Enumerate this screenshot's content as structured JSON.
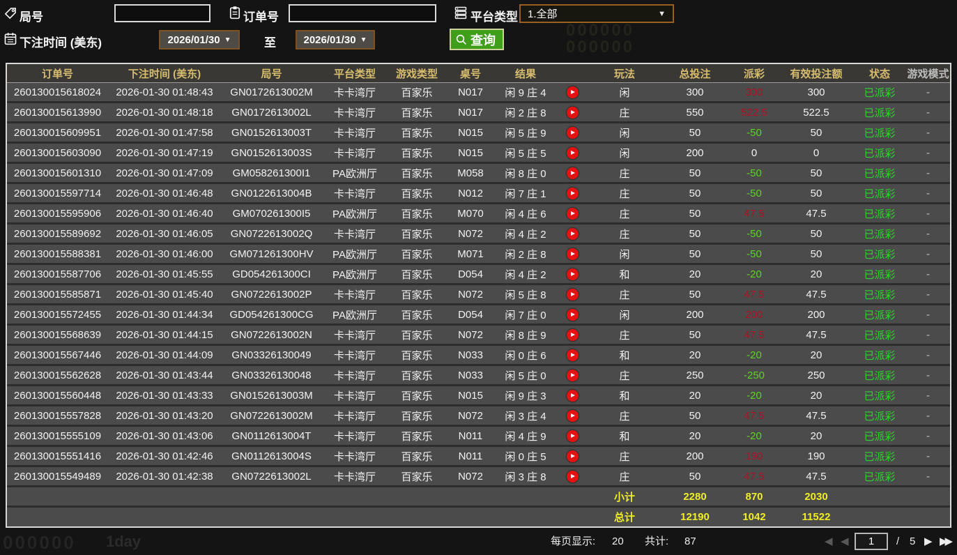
{
  "colors": {
    "gold": "#d8bd6e",
    "win": "#b01126",
    "loss": "#5bd61f",
    "status": "#2fd32f",
    "yellow": "#f0ee22",
    "btn-green": "#3f9e1a"
  },
  "watermarks": [
    "000000",
    "000000",
    "000000",
    "1day"
  ],
  "filters": {
    "round_label": "局号",
    "order_label": "订单号",
    "platform_label": "平台类型",
    "platform_value": "1.全部",
    "bet_time_label": "下注时间 (美东)",
    "date_from": "2026/01/30",
    "date_to": "2026/01/30",
    "to_label": "至",
    "search_label": "查询",
    "round_value": "",
    "order_value": ""
  },
  "icons": {
    "caret": "▼",
    "first": "◀",
    "prev": "◀",
    "next": "▶",
    "last": "▶▶"
  },
  "table": {
    "headers": [
      "订单号",
      "下注时间 (美东)",
      "局号",
      "平台类型",
      "游戏类型",
      "桌号",
      "结果",
      "",
      "玩法",
      "总投注",
      "派彩",
      "有效投注额",
      "状态",
      "游戏模式"
    ],
    "fields": [
      "order",
      "time",
      "round",
      "platform",
      "game",
      "table",
      "result",
      "play",
      "bet",
      "total",
      "payout",
      "valid",
      "status",
      "mode"
    ],
    "rows": [
      {
        "order": "260130015618024",
        "time": "2026-01-30 01:48:43",
        "round": "GN0172613002M",
        "platform": "卡卡湾厅",
        "game": "百家乐",
        "table": "N017",
        "result": "闲 9 庄 4",
        "bet": "闲",
        "total": "300",
        "payout": "300",
        "pclass": "win",
        "valid": "300",
        "status": "已派彩",
        "mode": "-"
      },
      {
        "order": "260130015613990",
        "time": "2026-01-30 01:48:18",
        "round": "GN0172613002L",
        "platform": "卡卡湾厅",
        "game": "百家乐",
        "table": "N017",
        "result": "闲 2 庄 8",
        "bet": "庄",
        "total": "550",
        "payout": "522.5",
        "pclass": "win",
        "valid": "522.5",
        "status": "已派彩",
        "mode": "-"
      },
      {
        "order": "260130015609951",
        "time": "2026-01-30 01:47:58",
        "round": "GN0152613003T",
        "platform": "卡卡湾厅",
        "game": "百家乐",
        "table": "N015",
        "result": "闲 5 庄 9",
        "bet": "闲",
        "total": "50",
        "payout": "-50",
        "pclass": "loss",
        "valid": "50",
        "status": "已派彩",
        "mode": "-"
      },
      {
        "order": "260130015603090",
        "time": "2026-01-30 01:47:19",
        "round": "GN0152613003S",
        "platform": "卡卡湾厅",
        "game": "百家乐",
        "table": "N015",
        "result": "闲 5 庄 5",
        "bet": "闲",
        "total": "200",
        "payout": "0",
        "pclass": "zero",
        "valid": "0",
        "status": "已派彩",
        "mode": "-"
      },
      {
        "order": "260130015601310",
        "time": "2026-01-30 01:47:09",
        "round": "GM058261300I1",
        "platform": "PA欧洲厅",
        "game": "百家乐",
        "table": "M058",
        "result": "闲 8 庄 0",
        "bet": "庄",
        "total": "50",
        "payout": "-50",
        "pclass": "loss",
        "valid": "50",
        "status": "已派彩",
        "mode": "-"
      },
      {
        "order": "260130015597714",
        "time": "2026-01-30 01:46:48",
        "round": "GN0122613004B",
        "platform": "卡卡湾厅",
        "game": "百家乐",
        "table": "N012",
        "result": "闲 7 庄 1",
        "bet": "庄",
        "total": "50",
        "payout": "-50",
        "pclass": "loss",
        "valid": "50",
        "status": "已派彩",
        "mode": "-"
      },
      {
        "order": "260130015595906",
        "time": "2026-01-30 01:46:40",
        "round": "GM070261300I5",
        "platform": "PA欧洲厅",
        "game": "百家乐",
        "table": "M070",
        "result": "闲 4 庄 6",
        "bet": "庄",
        "total": "50",
        "payout": "47.5",
        "pclass": "win",
        "valid": "47.5",
        "status": "已派彩",
        "mode": "-"
      },
      {
        "order": "260130015589692",
        "time": "2026-01-30 01:46:05",
        "round": "GN0722613002Q",
        "platform": "卡卡湾厅",
        "game": "百家乐",
        "table": "N072",
        "result": "闲 4 庄 2",
        "bet": "庄",
        "total": "50",
        "payout": "-50",
        "pclass": "loss",
        "valid": "50",
        "status": "已派彩",
        "mode": "-"
      },
      {
        "order": "260130015588381",
        "time": "2026-01-30 01:46:00",
        "round": "GM071261300HV",
        "platform": "PA欧洲厅",
        "game": "百家乐",
        "table": "M071",
        "result": "闲 2 庄 8",
        "bet": "闲",
        "total": "50",
        "payout": "-50",
        "pclass": "loss",
        "valid": "50",
        "status": "已派彩",
        "mode": "-"
      },
      {
        "order": "260130015587706",
        "time": "2026-01-30 01:45:55",
        "round": "GD054261300CI",
        "platform": "PA欧洲厅",
        "game": "百家乐",
        "table": "D054",
        "result": "闲 4 庄 2",
        "bet": "和",
        "total": "20",
        "payout": "-20",
        "pclass": "loss",
        "valid": "20",
        "status": "已派彩",
        "mode": "-"
      },
      {
        "order": "260130015585871",
        "time": "2026-01-30 01:45:40",
        "round": "GN0722613002P",
        "platform": "卡卡湾厅",
        "game": "百家乐",
        "table": "N072",
        "result": "闲 5 庄 8",
        "bet": "庄",
        "total": "50",
        "payout": "47.5",
        "pclass": "win",
        "valid": "47.5",
        "status": "已派彩",
        "mode": "-"
      },
      {
        "order": "260130015572455",
        "time": "2026-01-30 01:44:34",
        "round": "GD054261300CG",
        "platform": "PA欧洲厅",
        "game": "百家乐",
        "table": "D054",
        "result": "闲 7 庄 0",
        "bet": "闲",
        "total": "200",
        "payout": "200",
        "pclass": "win",
        "valid": "200",
        "status": "已派彩",
        "mode": "-"
      },
      {
        "order": "260130015568639",
        "time": "2026-01-30 01:44:15",
        "round": "GN0722613002N",
        "platform": "卡卡湾厅",
        "game": "百家乐",
        "table": "N072",
        "result": "闲 8 庄 9",
        "bet": "庄",
        "total": "50",
        "payout": "47.5",
        "pclass": "win",
        "valid": "47.5",
        "status": "已派彩",
        "mode": "-"
      },
      {
        "order": "260130015567446",
        "time": "2026-01-30 01:44:09",
        "round": "GN03326130049",
        "platform": "卡卡湾厅",
        "game": "百家乐",
        "table": "N033",
        "result": "闲 0 庄 6",
        "bet": "和",
        "total": "20",
        "payout": "-20",
        "pclass": "loss",
        "valid": "20",
        "status": "已派彩",
        "mode": "-"
      },
      {
        "order": "260130015562628",
        "time": "2026-01-30 01:43:44",
        "round": "GN03326130048",
        "platform": "卡卡湾厅",
        "game": "百家乐",
        "table": "N033",
        "result": "闲 5 庄 0",
        "bet": "庄",
        "total": "250",
        "payout": "-250",
        "pclass": "loss",
        "valid": "250",
        "status": "已派彩",
        "mode": "-"
      },
      {
        "order": "260130015560448",
        "time": "2026-01-30 01:43:33",
        "round": "GN0152613003M",
        "platform": "卡卡湾厅",
        "game": "百家乐",
        "table": "N015",
        "result": "闲 9 庄 3",
        "bet": "和",
        "total": "20",
        "payout": "-20",
        "pclass": "loss",
        "valid": "20",
        "status": "已派彩",
        "mode": "-"
      },
      {
        "order": "260130015557828",
        "time": "2026-01-30 01:43:20",
        "round": "GN0722613002M",
        "platform": "卡卡湾厅",
        "game": "百家乐",
        "table": "N072",
        "result": "闲 3 庄 4",
        "bet": "庄",
        "total": "50",
        "payout": "47.5",
        "pclass": "win",
        "valid": "47.5",
        "status": "已派彩",
        "mode": "-"
      },
      {
        "order": "260130015555109",
        "time": "2026-01-30 01:43:06",
        "round": "GN0112613004T",
        "platform": "卡卡湾厅",
        "game": "百家乐",
        "table": "N011",
        "result": "闲 4 庄 9",
        "bet": "和",
        "total": "20",
        "payout": "-20",
        "pclass": "loss",
        "valid": "20",
        "status": "已派彩",
        "mode": "-"
      },
      {
        "order": "260130015551416",
        "time": "2026-01-30 01:42:46",
        "round": "GN0112613004S",
        "platform": "卡卡湾厅",
        "game": "百家乐",
        "table": "N011",
        "result": "闲 0 庄 5",
        "bet": "庄",
        "total": "200",
        "payout": "190",
        "pclass": "win",
        "valid": "190",
        "status": "已派彩",
        "mode": "-"
      },
      {
        "order": "260130015549489",
        "time": "2026-01-30 01:42:38",
        "round": "GN0722613002L",
        "platform": "卡卡湾厅",
        "game": "百家乐",
        "table": "N072",
        "result": "闲 3 庄 8",
        "bet": "庄",
        "total": "50",
        "payout": "47.5",
        "pclass": "win",
        "valid": "47.5",
        "status": "已派彩",
        "mode": "-"
      }
    ]
  },
  "summary": {
    "subtotal_label": "小计",
    "subtotal_values": [
      "2280",
      "870",
      "2030"
    ],
    "total_label": "总计",
    "total_values": [
      "12190",
      "1042",
      "11522"
    ]
  },
  "footer": {
    "per_page_label": "每页显示:",
    "per_page_value": "20",
    "total_count_label": "共计:",
    "total_count_value": "87",
    "page_current": "1",
    "page_separator": "/",
    "page_total": "5"
  }
}
